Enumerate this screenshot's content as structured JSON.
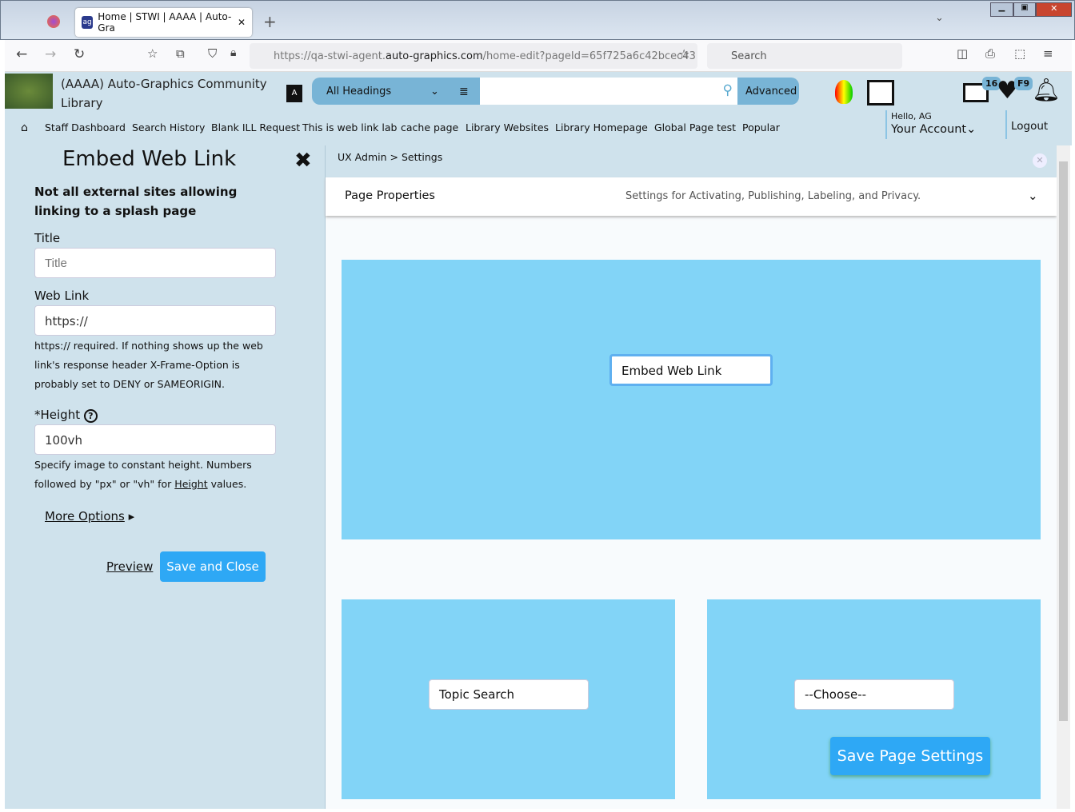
{
  "browser": {
    "tab_title": "Home | STWI | AAAA | Auto-Gra",
    "url_prefix": "https://qa-stwi-agent.",
    "url_domain": "auto-graphics.com",
    "url_suffix": "/home-edit?pageId=65f725a6c42bcec43",
    "search_placeholder": "Search"
  },
  "header": {
    "library_name": "(AAAA) Auto-Graphics Community Library",
    "search_scope": "All Headings",
    "advanced": "Advanced",
    "badge_list": "16",
    "badge_fav": "F9",
    "greeting": "Hello, AG",
    "account": "Your Account",
    "logout": "Logout",
    "nav": [
      "Staff Dashboard",
      "Search History",
      "Blank ILL Request",
      "This is web link lab",
      "cache page",
      "Library Websites",
      "Library Homepage",
      "Global Page test",
      "Popular"
    ]
  },
  "panel": {
    "title": "Embed Web Link",
    "warning": "Not all external sites allowing linking to a splash page",
    "title_label": "Title",
    "title_placeholder": "Title",
    "weblink_label": "Web Link",
    "weblink_value": "https://",
    "weblink_help": "https:// required. If nothing shows up the web link's response header X-Frame-Option is probably set to DENY or SAMEORIGIN.",
    "height_label": "*Height",
    "height_value": "100vh",
    "height_help_1": "Specify image to constant height. Numbers followed by \"px\" or \"vh\" for ",
    "height_help_link": "Height",
    "height_help_2": " values.",
    "more_options": "More Options",
    "preview": "Preview",
    "save_close": "Save and Close"
  },
  "main": {
    "breadcrumb": [
      "UX Admin",
      "Settings"
    ],
    "props_title": "Page Properties",
    "props_desc": "Settings for Activating, Publishing, Labeling, and Privacy.",
    "embed_box": "Embed Web Link",
    "topic_box": "Topic Search",
    "choose_box": "--Choose--",
    "save_settings": "Save Page Settings"
  }
}
